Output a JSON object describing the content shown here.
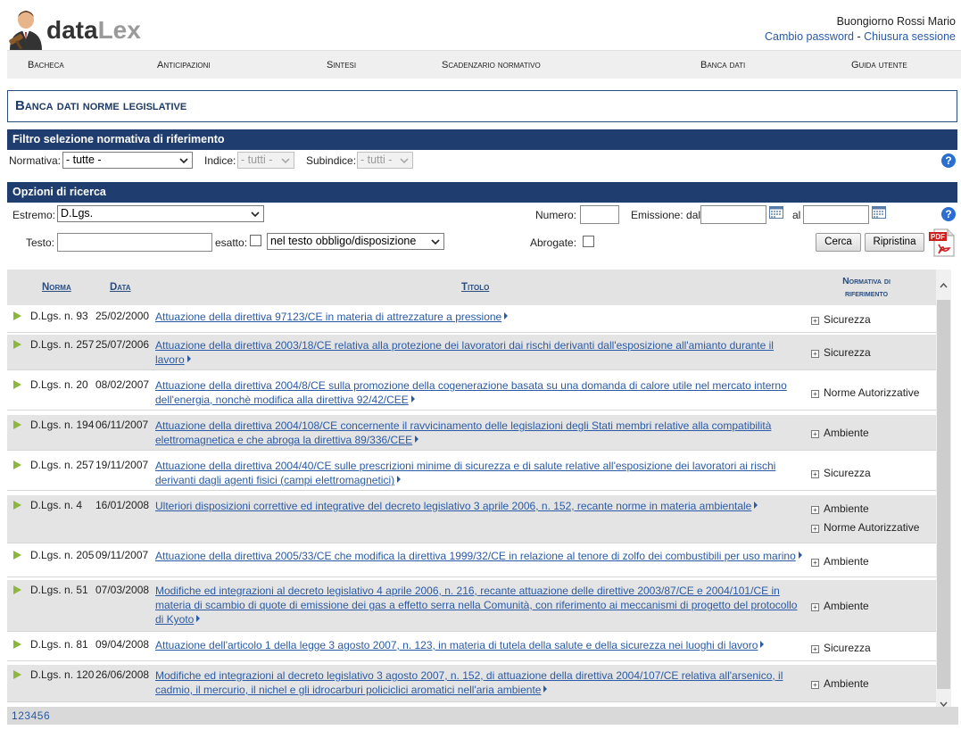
{
  "logo": {
    "part1": "data",
    "part2": "Lex"
  },
  "user": {
    "greeting": "Buongiorno Rossi Mario",
    "change_password": "Cambio password",
    "separator": "-",
    "logout": "Chiusura sessione"
  },
  "menu": {
    "items": [
      "Bacheca",
      "Anticipazioni",
      "Sintesi",
      "Scadenzario normativo",
      "Banca dati",
      "Guida utente"
    ]
  },
  "page_title": "Banca dati norme legislative",
  "filter": {
    "title": "Filtro selezione normativa di riferimento",
    "normativa_label": "Normativa:",
    "normativa_value": "- tutte -",
    "indice_label": "Indice:",
    "indice_value": "- tutti -",
    "subindice_label": "Subindice:",
    "subindice_value": "- tutti -"
  },
  "search": {
    "title": "Opzioni di ricerca",
    "estremo_label": "Estremo:",
    "estremo_value": "D.Lgs.",
    "numero_label": "Numero:",
    "numero_value": "",
    "emissione_label": "Emissione: dal",
    "dal_value": "",
    "al_label": "al",
    "al_value": "",
    "testo_label": "Testo:",
    "testo_value": "",
    "esatto_label": "esatto:",
    "scope_value": "nel testo obbligo/disposizione",
    "abrogate_label": "Abrogate:",
    "cerca_label": "Cerca",
    "ripristina_label": "Ripristina",
    "pdf_label": "PDF"
  },
  "table": {
    "headers": {
      "norma": "Norma",
      "data": "Data",
      "titolo": "Titolo",
      "normativa": "Normativa di riferimento"
    },
    "rows": [
      {
        "norma": "D.Lgs. n. 93",
        "data": "25/02/2000",
        "titolo": "Attuazione della direttiva 97123/CE in materia di attrezzature a pressione",
        "ref": [
          "Sicurezza"
        ]
      },
      {
        "norma": "D.Lgs. n. 257",
        "data": "25/07/2006",
        "titolo": "Attuazione della direttiva 2003/18/CE relativa alla protezione dei lavoratori dai rischi derivanti dall'esposizione all'amianto durante il lavoro",
        "ref": [
          "Sicurezza"
        ]
      },
      {
        "norma": "D.Lgs. n. 20",
        "data": "08/02/2007",
        "titolo": "Attuazione della direttiva 2004/8/CE sulla promozione della cogenerazione basata su una domanda di calore utile nel mercato interno dell'energia, nonchè modifica alla direttiva 92/42/CEE",
        "ref": [
          "Norme Autorizzative"
        ]
      },
      {
        "norma": "D.Lgs. n. 194",
        "data": "06/11/2007",
        "titolo": "Attuazione della direttiva 2004/108/CE concernente il ravvicinamento delle legislazioni degli Stati membri relative alla compatibilità elettromagnetica e che abroga la direttiva 89/336/CEE",
        "ref": [
          "Ambiente"
        ]
      },
      {
        "norma": "D.Lgs. n. 257",
        "data": "19/11/2007",
        "titolo": "Attuazione della direttiva 2004/40/CE sulle prescrizioni minime di sicurezza e di salute relative all'esposizione dei lavoratori ai rischi derivanti dagli agenti fisici (campi elettromagnetici)",
        "ref": [
          "Sicurezza"
        ]
      },
      {
        "norma": "D.Lgs. n. 4",
        "data": "16/01/2008",
        "titolo": "Ulteriori disposizioni correttive ed integrative del decreto legislativo 3 aprile 2006, n. 152, recante norme in materia ambientale",
        "ref": [
          "Ambiente",
          "Norme Autorizzative"
        ]
      },
      {
        "norma": "D.Lgs. n. 205",
        "data": "09/11/2007",
        "titolo": "Attuazione della direttiva 2005/33/CE che modifica la direttiva 1999/32/CE in relazione al tenore di zolfo dei combustibili per uso marino",
        "ref": [
          "Ambiente"
        ]
      },
      {
        "norma": "D.Lgs. n. 51",
        "data": "07/03/2008",
        "titolo": "Modifiche ed integrazioni al decreto legislativo 4 aprile 2006, n. 216, recante attuazione delle direttive 2003/87/CE e 2004/101/CE in materia di scambio di quote di emissione dei gas a effetto serra nella Comunità, con riferimento ai meccanismi di progetto del protocollo di Kyoto",
        "ref": [
          "Ambiente"
        ]
      },
      {
        "norma": "D.Lgs. n. 81",
        "data": "09/04/2008",
        "titolo": "Attuazione dell'articolo 1 della legge 3 agosto 2007, n. 123, in materia di tutela della salute e della sicurezza nei luoghi di lavoro",
        "ref": [
          "Sicurezza"
        ]
      },
      {
        "norma": "D.Lgs. n. 120",
        "data": "26/06/2008",
        "titolo": "Modifiche ed integrazioni al decreto legislativo 3 agosto 2007, n. 152, di attuazione della direttiva 2004/107/CE relativa all'arsenico, il cadmio, il mercurio, il nichel e gli idrocarburi policiclici aromatici nell'aria ambiente",
        "ref": [
          "Ambiente"
        ]
      }
    ]
  },
  "pager": {
    "pages": [
      "1",
      "2",
      "3",
      "4",
      "5",
      "6"
    ],
    "current": "1"
  },
  "colors": {
    "navy": "#1f3d6e",
    "link": "#2a5aa5",
    "play": "#8cb63c"
  }
}
